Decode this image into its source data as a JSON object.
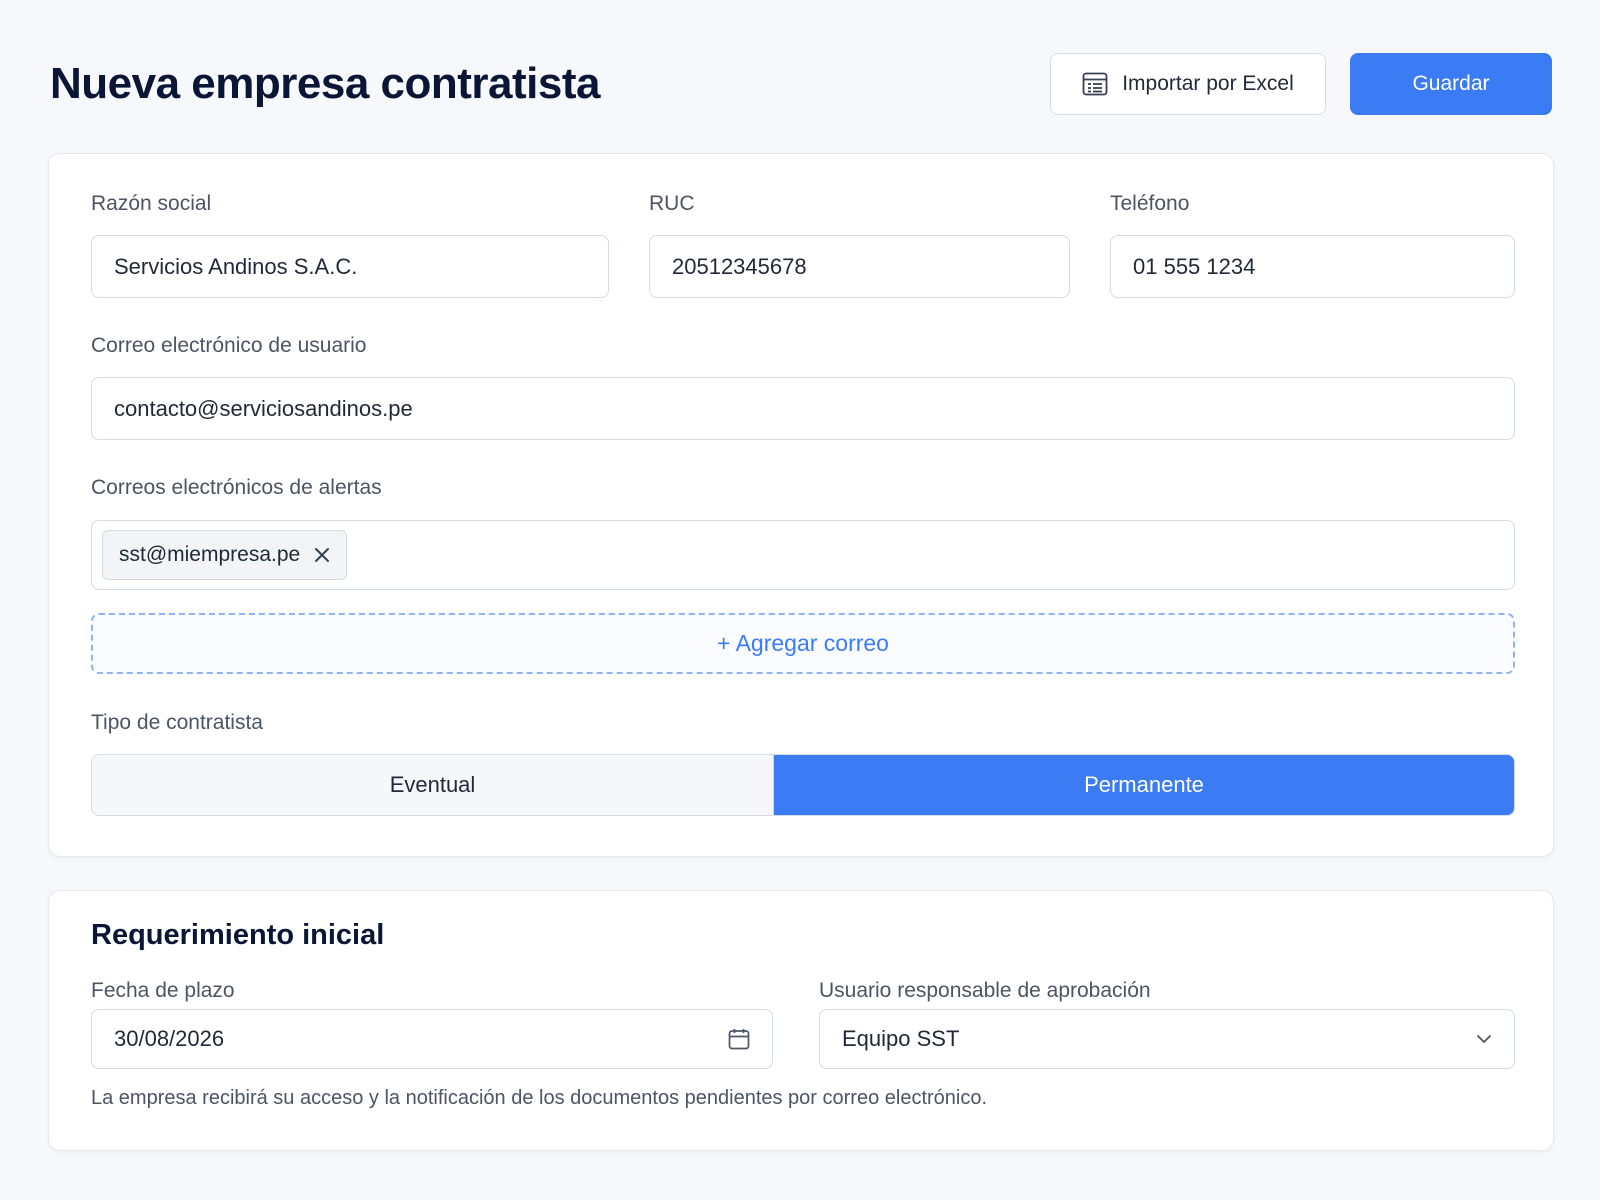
{
  "header": {
    "title": "Nueva empresa contratista",
    "import_label": "Importar por Excel",
    "save_label": "Guardar"
  },
  "company": {
    "razon_social": {
      "label": "Razón social",
      "value": "Servicios Andinos S.A.C."
    },
    "ruc": {
      "label": "RUC",
      "value": "20512345678"
    },
    "telefono": {
      "label": "Teléfono",
      "value": "01 555 1234"
    },
    "correo_usuario": {
      "label": "Correo electrónico de usuario",
      "value": "contacto@serviciosandinos.pe"
    },
    "correos_alertas": {
      "label": "Correos electrónicos de alertas",
      "chips": [
        "sst@miempresa.pe"
      ],
      "add_label": "+ Agregar correo"
    },
    "tipo": {
      "label": "Tipo de contratista",
      "options": [
        "Eventual",
        "Permanente"
      ],
      "selected": "Permanente"
    }
  },
  "requirement": {
    "title": "Requerimiento inicial",
    "fecha": {
      "label": "Fecha de plazo",
      "value": "30/08/2026"
    },
    "usuario": {
      "label": "Usuario responsable de aprobación",
      "value": "Equipo SST"
    },
    "helper": "La empresa recibirá su acceso y la notificación de los documentos pendientes por correo electrónico."
  },
  "colors": {
    "accent": "#3b7cf5",
    "title": "#0b1535",
    "border": "#d6dbe3"
  },
  "icons": [
    "spreadsheet-icon",
    "close-icon",
    "calendar-icon",
    "chevron-down-icon"
  ]
}
